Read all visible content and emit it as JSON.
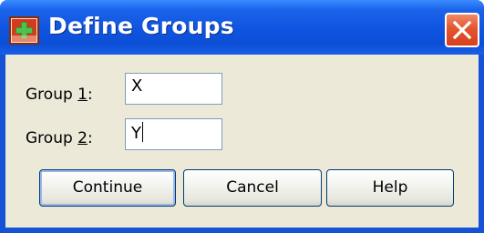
{
  "window": {
    "title": "Define Groups",
    "icon": "spss-dialog-icon",
    "close_icon": "close-icon"
  },
  "form": {
    "group1": {
      "label_pre": "Group ",
      "label_acc": "1",
      "label_post": ":",
      "value": "X"
    },
    "group2": {
      "label_pre": "Group ",
      "label_acc": "2",
      "label_post": ":",
      "value": "Y"
    }
  },
  "buttons": {
    "continue": "Continue",
    "cancel": "Cancel",
    "help": "Help"
  },
  "colors": {
    "titlebar": "#0c4fd6",
    "close_button": "#e4552f",
    "dialog_face": "#ece9d8"
  }
}
